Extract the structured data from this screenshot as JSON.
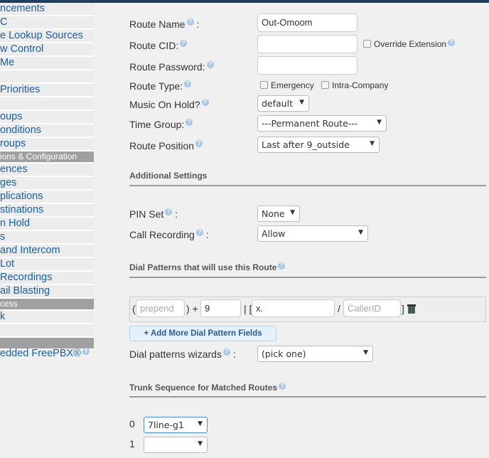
{
  "sidebar": {
    "items": [
      {
        "label": "ncements",
        "type": "item"
      },
      {
        "label": "C",
        "type": "item"
      },
      {
        "label": "e Lookup Sources",
        "type": "item"
      },
      {
        "label": "w Control",
        "type": "item"
      },
      {
        "label": "Me",
        "type": "item"
      },
      {
        "label": "",
        "type": "item"
      },
      {
        "label": "Priorities",
        "type": "item"
      },
      {
        "label": "",
        "type": "item"
      },
      {
        "label": "oups",
        "type": "item"
      },
      {
        "label": "onditions",
        "type": "item"
      },
      {
        "label": "roups",
        "type": "item"
      },
      {
        "label": "ions & Configuration",
        "type": "header"
      },
      {
        "label": "ences",
        "type": "item"
      },
      {
        "label": "ges",
        "type": "item"
      },
      {
        "label": "plications",
        "type": "item"
      },
      {
        "label": "stinations",
        "type": "item"
      },
      {
        "label": "n Hold",
        "type": "item"
      },
      {
        "label": "s",
        "type": "item"
      },
      {
        "label": "and Intercom",
        "type": "item"
      },
      {
        "label": " Lot",
        "type": "item"
      },
      {
        "label": " Recordings",
        "type": "item"
      },
      {
        "label": "ail Blasting",
        "type": "item"
      },
      {
        "label": "cess",
        "type": "header"
      },
      {
        "label": "k",
        "type": "item"
      },
      {
        "label": "",
        "type": "item"
      },
      {
        "label": "",
        "type": "header"
      }
    ],
    "footer": "edded FreePBX®"
  },
  "form": {
    "route_name_label": "Route Name",
    "route_name_value": "Out-Omoom",
    "route_cid_label": "Route CID:",
    "override_extension": "Override Extension",
    "route_password_label": "Route Password:",
    "route_type_label": "Route Type:",
    "emergency": "Emergency",
    "intra_company": "Intra-Company",
    "moh_label": "Music On Hold?",
    "moh_value": "default",
    "time_group_label": "Time Group:",
    "time_group_value": "---Permanent Route---",
    "route_position_label": "Route Position",
    "route_position_value": "Last after 9_outside",
    "colon": ":"
  },
  "additional": {
    "title": "Additional Settings",
    "pin_label": "PIN Set",
    "pin_value": "None",
    "recording_label": "Call Recording",
    "recording_value": "Allow"
  },
  "dial": {
    "title": "Dial Patterns that will use this Route",
    "prepend_placeholder": "prepend",
    "prefix_value": "9",
    "pattern_value": "x.",
    "callerid_placeholder": "CallerID",
    "open_paren": "(",
    "close_plus": ") +",
    "pipe_bracket": "| [",
    "slash": "/",
    "close_bracket": "]",
    "add_button": "+ Add More Dial Pattern Fields",
    "wizard_label": "Dial patterns wizards",
    "wizard_value": "(pick one)"
  },
  "trunks": {
    "title": "Trunk Sequence for Matched Routes",
    "rows": [
      {
        "index": "0",
        "value": "7line-g1"
      },
      {
        "index": "1",
        "value": ""
      }
    ]
  },
  "icons": {
    "help": "question-circle-icon",
    "trash": "trash-icon",
    "dropdown": "triangle-down-icon"
  },
  "colors": {
    "topbar": "#1f3f60",
    "link": "#1a5fa8",
    "section_header": "#a0a0a0"
  }
}
